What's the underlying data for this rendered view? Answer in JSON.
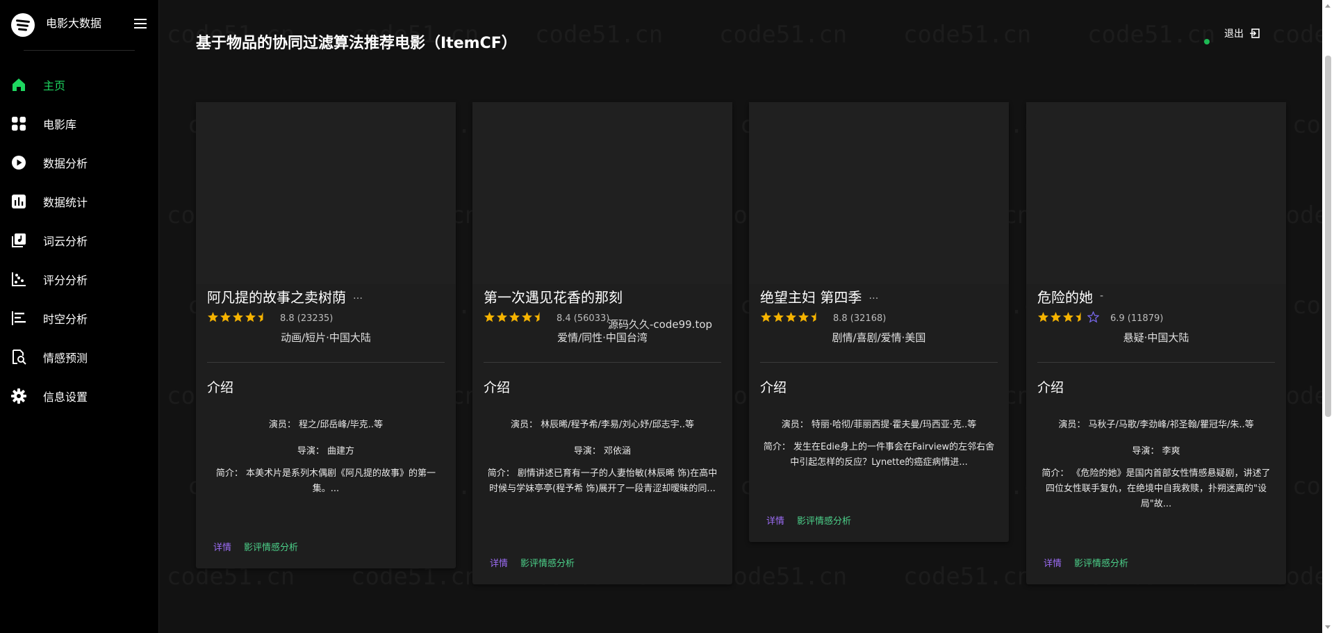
{
  "app": {
    "title": "电影大数据"
  },
  "sidebar": {
    "items": [
      {
        "label": "主页",
        "icon": "home-icon",
        "active": true
      },
      {
        "label": "电影库",
        "icon": "grid-icon",
        "active": false
      },
      {
        "label": "数据分析",
        "icon": "play-circle-icon",
        "active": false
      },
      {
        "label": "数据统计",
        "icon": "bar-chart-icon",
        "active": false
      },
      {
        "label": "词云分析",
        "icon": "library-icon",
        "active": false
      },
      {
        "label": "评分分析",
        "icon": "scatter-icon",
        "active": false
      },
      {
        "label": "时空分析",
        "icon": "timeline-icon",
        "active": false
      },
      {
        "label": "情感预测",
        "icon": "search-doc-icon",
        "active": false
      },
      {
        "label": "信息设置",
        "icon": "gear-icon",
        "active": false
      }
    ]
  },
  "header": {
    "title": "基于物品的协同过滤算法推荐电影（ItemCF）",
    "logout_label": "退出"
  },
  "watermark": {
    "text": "code51.cn",
    "center_text": "源码久久-code99.top"
  },
  "colors": {
    "accent": "#1ed760",
    "detail": "#9c6cf5",
    "sentiment": "#4cd18a",
    "star": "#f5b301"
  },
  "cards": [
    {
      "title": "阿凡提的故事之卖树荫",
      "title_suffix": "…",
      "stars": 4.5,
      "rating_text": "8.8 (23235)",
      "genre": "动画/短片·中国大陆",
      "intro_label": "介绍",
      "actors": "演员： 程之/邱岳峰/毕克..等",
      "director": "导演： 曲建方",
      "summary": "简介： 本美术片是系列木偶剧《阿凡提的故事》的第一集。...",
      "detail_label": "详情",
      "sentiment_label": "影评情感分析"
    },
    {
      "title": "第一次遇见花香的那刻",
      "title_suffix": "",
      "stars": 4.5,
      "rating_text": "8.4 (56033)",
      "genre": "爱情/同性·中国台湾",
      "intro_label": "介绍",
      "actors": "演员： 林辰晞/程予希/李易/刘心妤/邱志宇..等",
      "director": "导演： 邓依涵",
      "summary": "简介： 剧情讲述已育有一子的人妻怡敏(林辰晞 饰)在高中时候与学妹亭亭(程予希 饰)展开了一段青涩却暧昧的同...",
      "detail_label": "详情",
      "sentiment_label": "影评情感分析"
    },
    {
      "title": "绝望主妇 第四季",
      "title_suffix": "…",
      "stars": 4.5,
      "rating_text": "8.8 (32168)",
      "genre": "剧情/喜剧/爱情·美国",
      "intro_label": "介绍",
      "actors": "演员： 特丽·哈彻/菲丽西提·霍夫曼/玛西亚·克..等",
      "director": "",
      "summary": "简介： 发生在Edie身上的一件事会在Fairview的左邻右舍中引起怎样的反应？Lynette的癌症病情进...",
      "detail_label": "详情",
      "sentiment_label": "影评情感分析"
    },
    {
      "title": "危险的她",
      "title_suffix": "-",
      "stars": 3.5,
      "rating_text": "6.9 (11879)",
      "genre": "悬疑·中国大陆",
      "intro_label": "介绍",
      "actors": "演员： 马秋子/马歌/李劲峰/祁圣翰/瞿冠华/朱..等",
      "director": "导演： 李爽",
      "summary": "简介： 《危险的她》是国内首部女性情感悬疑剧，讲述了四位女性联手复仇，在绝境中自我救赎，扑朔迷离的\"设局\"故...",
      "detail_label": "详情",
      "sentiment_label": "影评情感分析"
    }
  ]
}
